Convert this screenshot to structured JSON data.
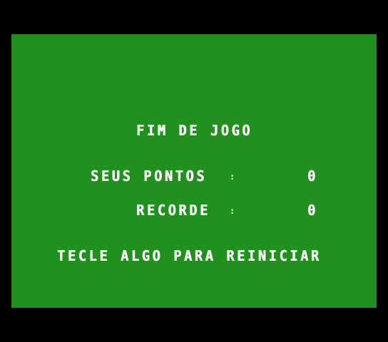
{
  "title": "FIM DE JOGO",
  "score": {
    "label": "SEUS PONTOS",
    "separator": ":",
    "value": "0"
  },
  "record": {
    "label": "RECORDE",
    "separator": ":",
    "value": "0"
  },
  "prompt": "TECLE ALGO PARA REINICIAR",
  "colors": {
    "border": "#000000",
    "background": "#21901f",
    "text": "#ffffff"
  }
}
